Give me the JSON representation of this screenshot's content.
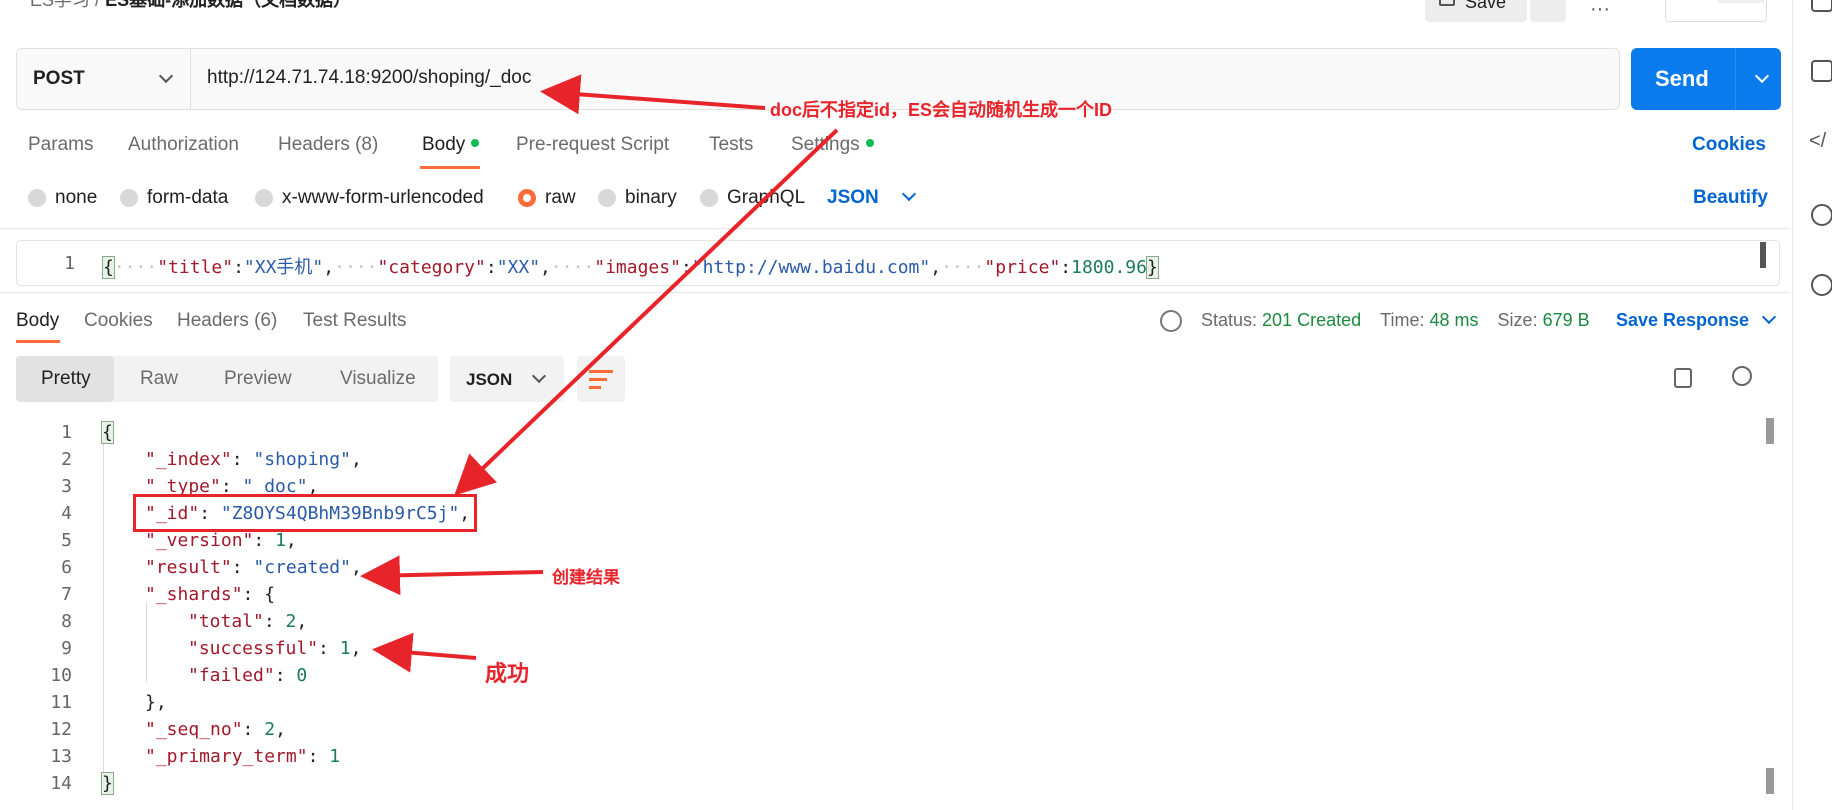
{
  "breadcrumb": {
    "parent": "ES学习",
    "separator": "/",
    "current": "ES基础-添加数据（文档数据）"
  },
  "header_buttons": {
    "save": "Save"
  },
  "request": {
    "method": "POST",
    "url": "http://124.71.74.18:9200/shoping/_doc",
    "send_label": "Send"
  },
  "request_tabs": [
    {
      "label": "Params"
    },
    {
      "label": "Authorization"
    },
    {
      "label": "Headers (8)"
    },
    {
      "label": "Body"
    },
    {
      "label": "Pre-request Script"
    },
    {
      "label": "Tests"
    },
    {
      "label": "Settings"
    }
  ],
  "cookies_link": "Cookies",
  "beautify_link": "Beautify",
  "body_modes": [
    {
      "label": "none"
    },
    {
      "label": "form-data"
    },
    {
      "label": "x-www-form-urlencoded"
    },
    {
      "label": "raw",
      "selected": true
    },
    {
      "label": "binary"
    },
    {
      "label": "GraphQL"
    }
  ],
  "raw_format": "JSON",
  "request_body": {
    "line_no": "1",
    "open": "{",
    "k1": "\"title\"",
    "v1": "\"XX手机\"",
    "k2": "\"category\"",
    "v2": "\"XX\"",
    "k3": "\"images\"",
    "v3": "\"http://www.baidu.com\"",
    "k4": "\"price\"",
    "v4": "1800.96",
    "close": "}"
  },
  "response_tabs": [
    {
      "label": "Body"
    },
    {
      "label": "Cookies"
    },
    {
      "label": "Headers (6)"
    },
    {
      "label": "Test Results"
    }
  ],
  "response_status": {
    "status_label": "Status:",
    "status_value": "201 Created",
    "time_label": "Time:",
    "time_value": "48 ms",
    "size_label": "Size:",
    "size_value": "679 B",
    "save_response": "Save Response"
  },
  "view_modes": [
    {
      "label": "Pretty"
    },
    {
      "label": "Raw"
    },
    {
      "label": "Preview"
    },
    {
      "label": "Visualize"
    }
  ],
  "response_format": "JSON",
  "response_lines": [
    {
      "n": "1",
      "text": "{"
    },
    {
      "n": "2",
      "key": "\"_index\"",
      "sep": ": ",
      "val": "\"shoping\"",
      "tail": ","
    },
    {
      "n": "3",
      "key": "\"_type\"",
      "sep": ": ",
      "val": "\"_doc\"",
      "tail": ","
    },
    {
      "n": "4",
      "key": "\"_id\"",
      "sep": ": ",
      "val": "\"Z8OYS4QBhM39Bnb9rC5j\"",
      "tail": ","
    },
    {
      "n": "5",
      "key": "\"_version\"",
      "sep": ": ",
      "num": "1",
      "tail": ","
    },
    {
      "n": "6",
      "key": "\"result\"",
      "sep": ": ",
      "val": "\"created\"",
      "tail": ","
    },
    {
      "n": "7",
      "key": "\"_shards\"",
      "sep": ": ",
      "tail": "{"
    },
    {
      "n": "8",
      "key": "\"total\"",
      "sep": ": ",
      "num": "2",
      "tail": ","
    },
    {
      "n": "9",
      "key": "\"successful\"",
      "sep": ": ",
      "num": "1",
      "tail": ","
    },
    {
      "n": "10",
      "key": "\"failed\"",
      "sep": ": ",
      "num": "0",
      "tail": ""
    },
    {
      "n": "11",
      "text": "},"
    },
    {
      "n": "12",
      "key": "\"_seq_no\"",
      "sep": ": ",
      "num": "2",
      "tail": ","
    },
    {
      "n": "13",
      "key": "\"_primary_term\"",
      "sep": ": ",
      "num": "1",
      "tail": ""
    },
    {
      "n": "14",
      "text": "}"
    }
  ],
  "annotations": {
    "doc_note": "doc后不指定id，ES会自动随机生成一个ID",
    "created_note": "创建结果",
    "success_note": "成功",
    "color": "#e8242b"
  },
  "colors": {
    "accent": "#ff6c37",
    "primary": "#097bed",
    "link": "#0265d2",
    "success": "#1b8a3f"
  }
}
